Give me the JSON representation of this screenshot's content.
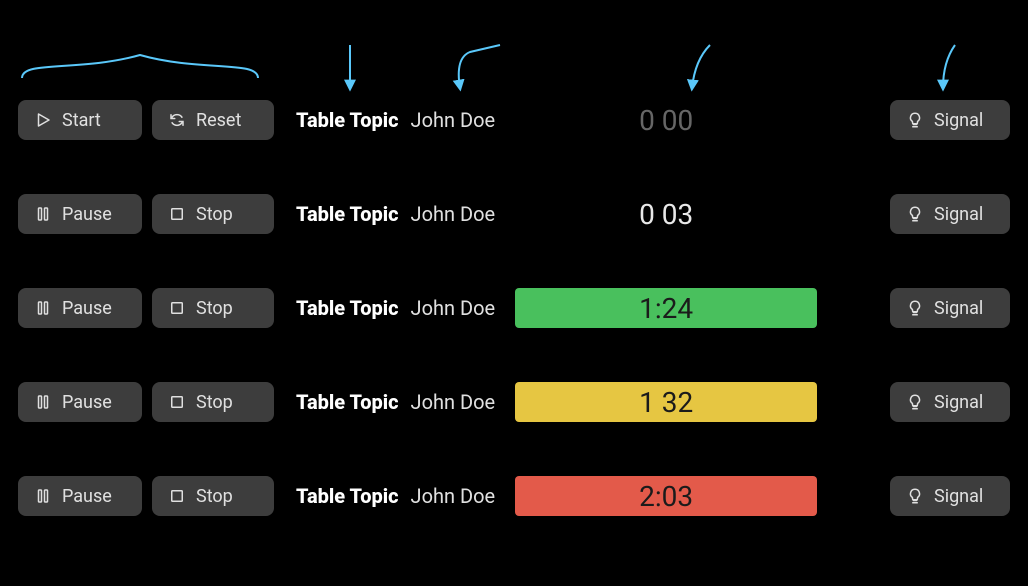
{
  "buttons": {
    "start": "Start",
    "reset": "Reset",
    "pause": "Pause",
    "stop": "Stop",
    "signal": "Signal"
  },
  "title": "Table Topic",
  "speaker": "John Doe",
  "rows": [
    {
      "btnA": "start",
      "btnB": "reset",
      "time": "0 00",
      "timerClass": "timer-none"
    },
    {
      "btnA": "pause",
      "btnB": "stop",
      "time": "0 03",
      "timerClass": "timer-plain"
    },
    {
      "btnA": "pause",
      "btnB": "stop",
      "time": "1:24",
      "timerClass": "timer-green"
    },
    {
      "btnA": "pause",
      "btnB": "stop",
      "time": "1 32",
      "timerClass": "timer-yellow"
    },
    {
      "btnA": "pause",
      "btnB": "stop",
      "time": "2:03",
      "timerClass": "timer-red"
    }
  ],
  "icons_stroke": "#e0e0e0",
  "arrow_color": "#5ac8fa"
}
